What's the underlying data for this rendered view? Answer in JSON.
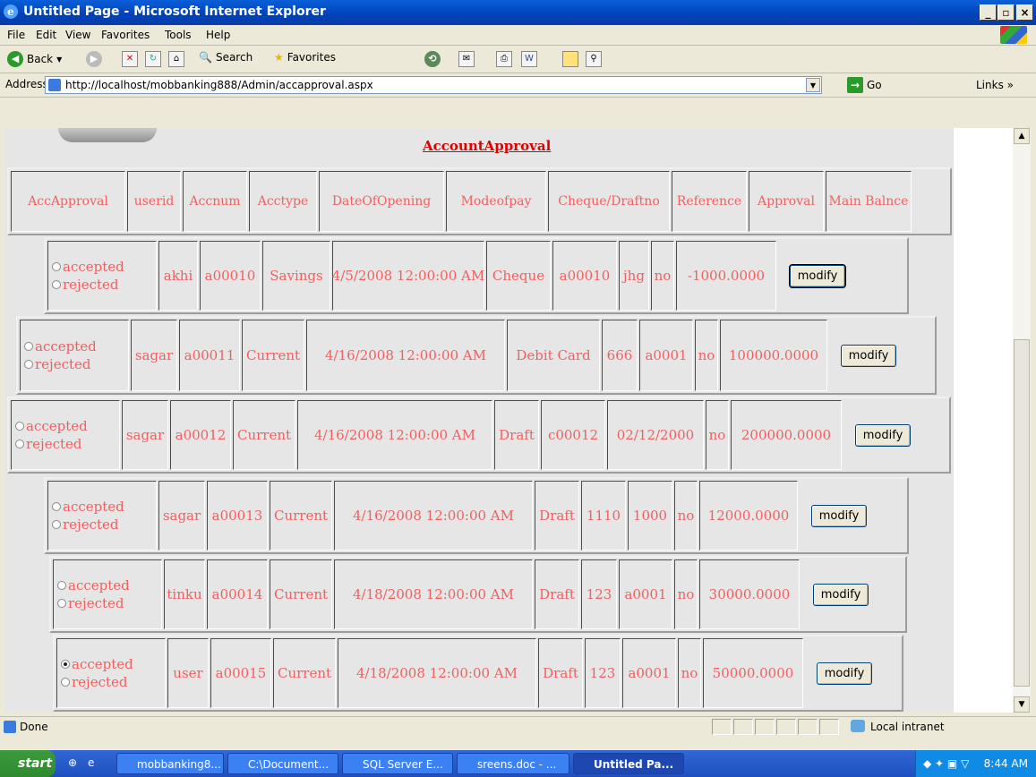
{
  "window": {
    "title": "Untitled Page - Microsoft Internet Explorer"
  },
  "menu": [
    "File",
    "Edit",
    "View",
    "Favorites",
    "Tools",
    "Help"
  ],
  "toolbar": {
    "back": "Back",
    "search": "Search",
    "favorites": "Favorites"
  },
  "address": {
    "label": "Address",
    "url": "http://localhost/mobbanking888/Admin/accapproval.aspx",
    "go": "Go",
    "links": "Links"
  },
  "page": {
    "title": "AccountApproval"
  },
  "table": {
    "headers": [
      "AccApproval",
      "userid",
      "Accnum",
      "Acctype",
      "DateOfOpening",
      "Modeofpay",
      "Cheque/Draftno",
      "Reference",
      "Approval",
      "Main Balnce"
    ],
    "radio_accept": "accepted",
    "radio_reject": "rejected",
    "button": "modify",
    "rows": [
      {
        "selected": "",
        "userid": "akhi",
        "accnum": "a00010",
        "acctype": "Savings",
        "date": "4/5/2008 12:00:00 AM",
        "mode": "Cheque",
        "cheque": "a00010",
        "reference": "jhg",
        "approval": "no",
        "balance": "-1000.0000"
      },
      {
        "selected": "",
        "userid": "sagar",
        "accnum": "a00011",
        "acctype": "Current",
        "date": "4/16/2008 12:00:00 AM",
        "mode": "Debit Card",
        "cheque": "666",
        "reference": "a0001",
        "approval": "no",
        "balance": "100000.0000"
      },
      {
        "selected": "",
        "userid": "sagar",
        "accnum": "a00012",
        "acctype": "Current",
        "date": "4/16/2008 12:00:00 AM",
        "mode": "Draft",
        "cheque": "c00012",
        "reference": "02/12/2000",
        "approval": "no",
        "balance": "200000.0000"
      },
      {
        "selected": "",
        "userid": "sagar",
        "accnum": "a00013",
        "acctype": "Current",
        "date": "4/16/2008 12:00:00 AM",
        "mode": "Draft",
        "cheque": "1110",
        "reference": "1000",
        "approval": "no",
        "balance": "12000.0000"
      },
      {
        "selected": "",
        "userid": "tinku",
        "accnum": "a00014",
        "acctype": "Current",
        "date": "4/18/2008 12:00:00 AM",
        "mode": "Draft",
        "cheque": "123",
        "reference": "a0001",
        "approval": "no",
        "balance": "30000.0000"
      },
      {
        "selected": "accepted",
        "userid": "user",
        "accnum": "a00015",
        "acctype": "Current",
        "date": "4/18/2008 12:00:00 AM",
        "mode": "Draft",
        "cheque": "123",
        "reference": "a0001",
        "approval": "no",
        "balance": "50000.0000"
      }
    ]
  },
  "status": {
    "text": "Done",
    "zone": "Local intranet"
  },
  "taskbar": {
    "start": "start",
    "tasks": [
      "mobbanking8...",
      "C:\\Document...",
      "SQL Server E...",
      "sreens.doc - ...",
      "Untitled Pa..."
    ],
    "clock": "8:44 AM"
  },
  "colors": {
    "cell_text": "#f06060",
    "title_text": "#e00000",
    "panel": "#e6e6e6"
  }
}
